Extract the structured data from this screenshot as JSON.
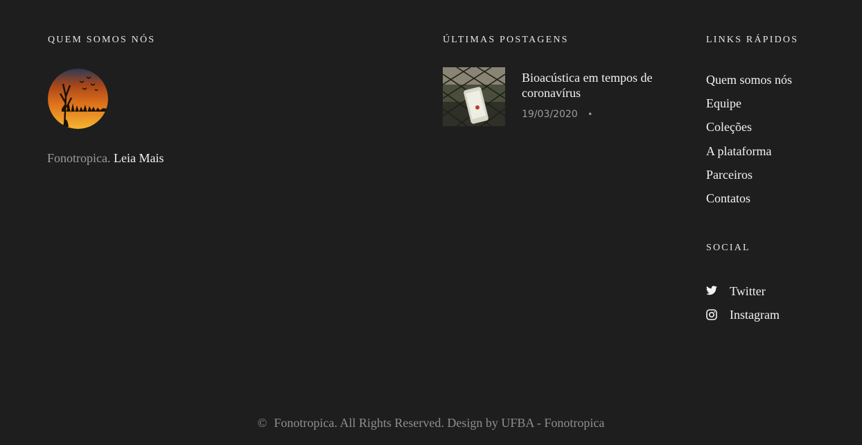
{
  "about": {
    "heading": "QUEM SOMOS NÓS",
    "logo_icon": "fonotropica-sunset-logo-icon",
    "text": "Fonotropica.",
    "read_more": "Leia Mais"
  },
  "recent_posts": {
    "heading": "ÚLTIMAS POSTAGENS",
    "items": [
      {
        "title": "Bioacústica em tempos de coronavírus",
        "date": "19/03/2020",
        "separator": "•"
      }
    ]
  },
  "quick_links": {
    "heading": "LINKS RÁPIDOS",
    "items": [
      {
        "label": "Quem somos nós"
      },
      {
        "label": "Equipe"
      },
      {
        "label": "Coleções"
      },
      {
        "label": "A plataforma"
      },
      {
        "label": "Parceiros"
      },
      {
        "label": "Contatos"
      }
    ]
  },
  "social": {
    "heading": "SOCIAL",
    "items": [
      {
        "label": "Twitter",
        "icon": "twitter-icon"
      },
      {
        "label": "Instagram",
        "icon": "instagram-icon"
      }
    ]
  },
  "copyright": {
    "symbol": "©",
    "text": "Fonotropica. All Rights Reserved. Design by UFBA - Fonotropica"
  },
  "colors": {
    "background": "#1e1e1e",
    "text": "#f2f2f2",
    "muted": "#9c9c9c"
  }
}
